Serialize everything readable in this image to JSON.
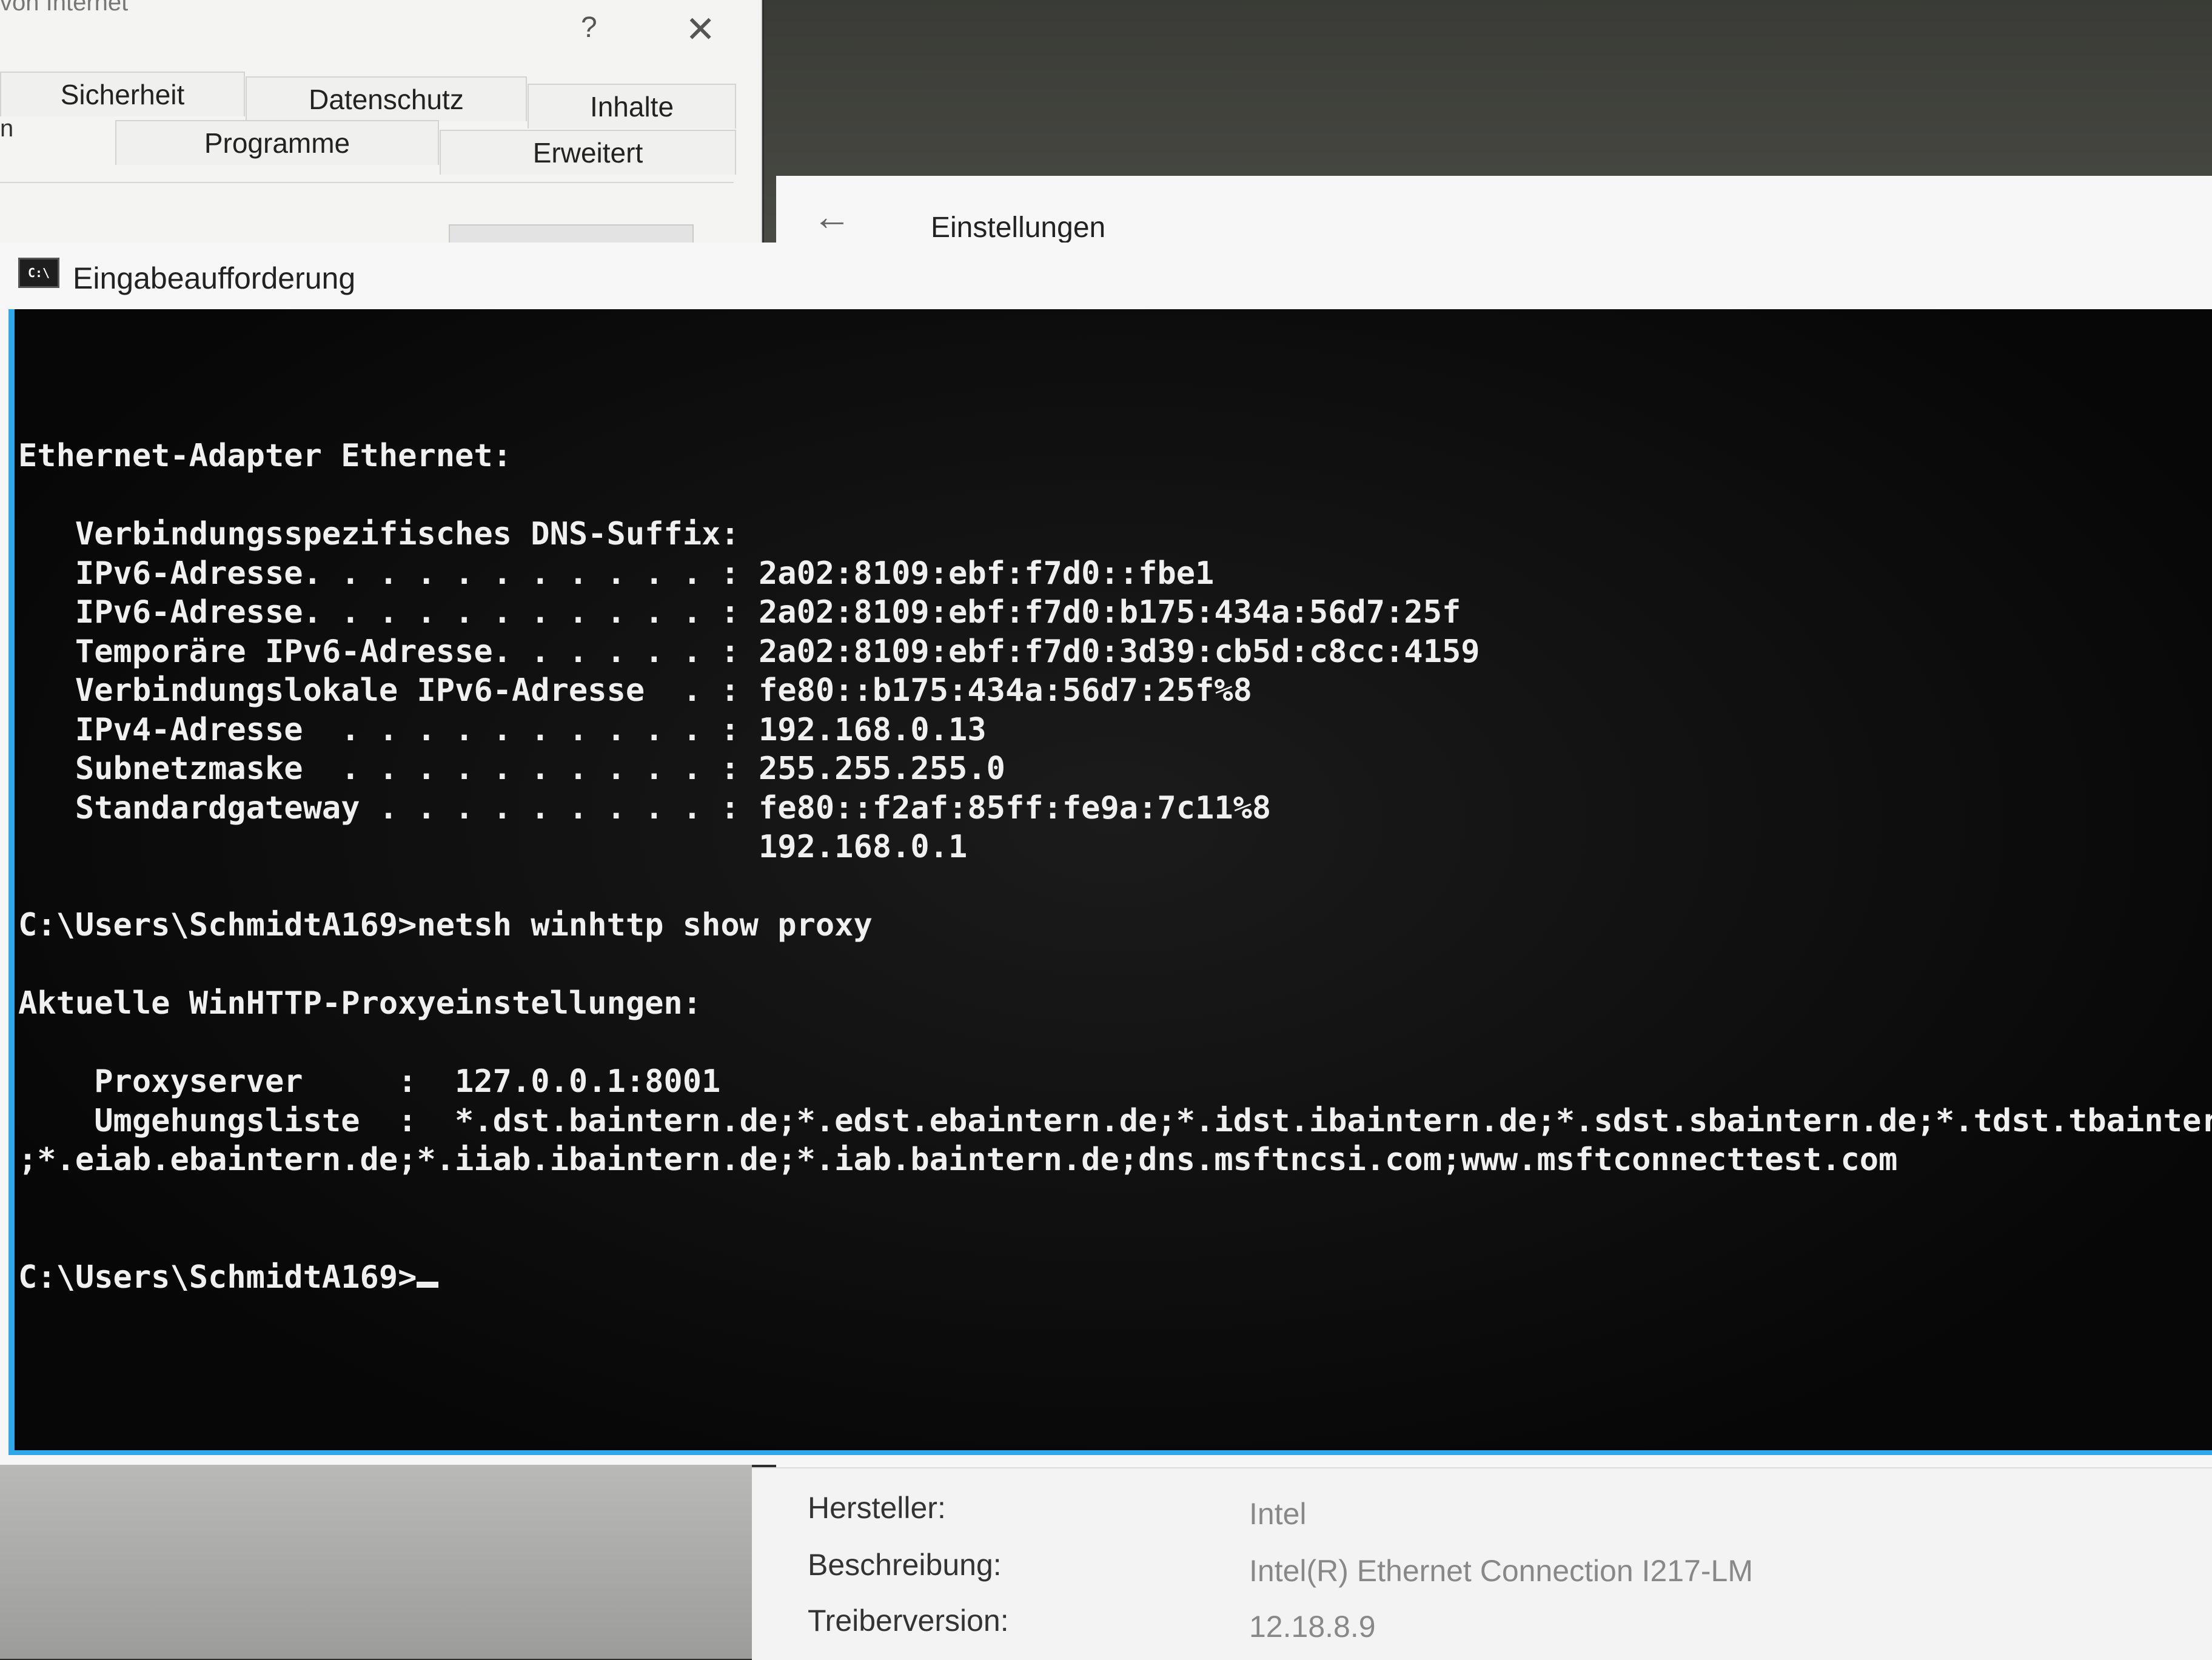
{
  "internet_options": {
    "title_fragment": "von Internet",
    "help_label": "?",
    "close_label": "✕",
    "tabs_row1": [
      "Sicherheit",
      "Datenschutz",
      "Inhalte"
    ],
    "tabs_row2": [
      "Programme",
      "Erweitert"
    ],
    "tab_stub": "n"
  },
  "settings_window": {
    "back_label": "←",
    "title": "Einstellungen",
    "minimize_label": "—"
  },
  "cmd_window": {
    "title": "Eingabeaufforderung",
    "icon_label": "C:\\",
    "lines": [
      "Ethernet-Adapter Ethernet:",
      "",
      "   Verbindungsspezifisches DNS-Suffix:",
      "   IPv6-Adresse. . . . . . . . . . . : 2a02:8109:ebf:f7d0::fbe1",
      "   IPv6-Adresse. . . . . . . . . . . : 2a02:8109:ebf:f7d0:b175:434a:56d7:25f",
      "   Temporäre IPv6-Adresse. . . . . . : 2a02:8109:ebf:f7d0:3d39:cb5d:c8cc:4159",
      "   Verbindungslokale IPv6-Adresse  . : fe80::b175:434a:56d7:25f%8",
      "   IPv4-Adresse  . . . . . . . . . . : 192.168.0.13",
      "   Subnetzmaske  . . . . . . . . . . : 255.255.255.0",
      "   Standardgateway . . . . . . . . . : fe80::f2af:85ff:fe9a:7c11%8",
      "                                       192.168.0.1",
      "",
      "C:\\Users\\SchmidtA169>netsh winhttp show proxy",
      "",
      "Aktuelle WinHTTP-Proxyeinstellungen:",
      "",
      "    Proxyserver     :  127.0.0.1:8001",
      "    Umgehungsliste  :  *.dst.baintern.de;*.edst.ebaintern.de;*.idst.ibaintern.de;*.sdst.sbaintern.de;*.tdst.tbaintern.d",
      ";*.eiab.ebaintern.de;*.iiab.ibaintern.de;*.iab.baintern.de;dns.msftncsi.com;www.msftconnecttest.com",
      "",
      ""
    ],
    "prompt": "C:\\Users\\SchmidtA169>"
  },
  "device_properties": {
    "rows": [
      {
        "label": "Hersteller:",
        "value": "Intel"
      },
      {
        "label": "Beschreibung:",
        "value": "Intel(R) Ethernet Connection I217-LM"
      },
      {
        "label": "Treiberversion:",
        "value": "12.18.8.9"
      }
    ]
  }
}
